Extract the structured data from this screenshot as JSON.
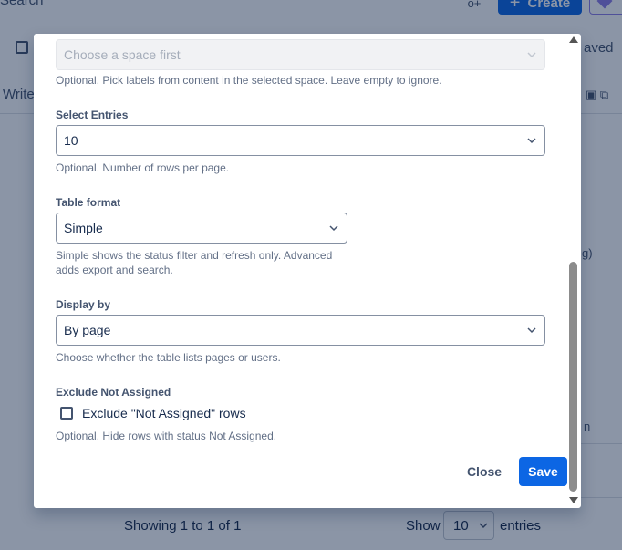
{
  "background": {
    "search_text": "Search",
    "invite_icon_text": "o+",
    "create_label": "Create",
    "saved_text": "aved",
    "write_text": "Write",
    "partial_g": "g)",
    "partial_n": "n",
    "showing_text": "Showing 1 to 1 of 1",
    "show_label": "Show",
    "page_size_value": "10",
    "entries_label": "entries"
  },
  "modal": {
    "labels_field": {
      "placeholder": "Choose a space first",
      "help": "Optional. Pick labels from content in the selected space. Leave empty to ignore."
    },
    "select_entries": {
      "label": "Select Entries",
      "value": "10",
      "help": "Optional. Number of rows per page."
    },
    "table_format": {
      "label": "Table format",
      "value": "Simple",
      "help_line1": "Simple shows the status filter and refresh only. Advanced",
      "help_line2": "adds export and search."
    },
    "display_by": {
      "label": "Display by",
      "value": "By page",
      "help": "Choose whether the table lists pages or users."
    },
    "exclude_not_assigned": {
      "label": "Exclude Not Assigned",
      "checkbox_label": "Exclude \"Not Assigned\" rows",
      "checked": false,
      "help": "Optional. Hide rows with status Not Assigned."
    },
    "buttons": {
      "close_label": "Close",
      "save_label": "Save"
    }
  },
  "colors": {
    "primary": "#0c66e4",
    "overlay": "#8a8a8a",
    "text": "#172b4d",
    "muted_text": "#626f86"
  }
}
